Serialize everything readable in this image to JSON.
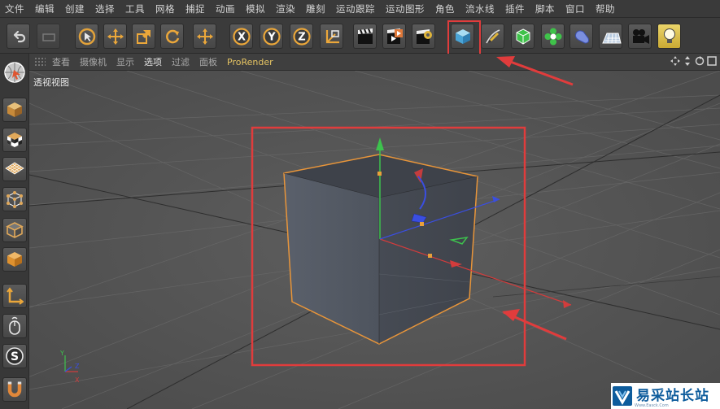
{
  "menubar": {
    "items": [
      "文件",
      "编辑",
      "创建",
      "选择",
      "工具",
      "网格",
      "捕捉",
      "动画",
      "模拟",
      "渲染",
      "雕刻",
      "运动跟踪",
      "运动图形",
      "角色",
      "流水线",
      "插件",
      "脚本",
      "窗口",
      "帮助"
    ]
  },
  "toolbar": {
    "buttons": [
      {
        "name": "undo",
        "icon": "undo-icon"
      },
      {
        "name": "redo",
        "icon": "redo-icon"
      },
      {
        "name": "live-select",
        "icon": "cursor-icon"
      },
      {
        "name": "move",
        "icon": "move-arrows-icon"
      },
      {
        "name": "scale",
        "icon": "scale-icon"
      },
      {
        "name": "rotate",
        "icon": "rotate-icon"
      },
      {
        "name": "recent-tool",
        "icon": "move-arrows-icon"
      },
      {
        "name": "x-axis",
        "label": "X"
      },
      {
        "name": "y-axis",
        "label": "Y"
      },
      {
        "name": "z-axis",
        "label": "Z"
      },
      {
        "name": "coordinate-system",
        "icon": "coordinate-icon"
      },
      {
        "name": "render-view",
        "icon": "clapboard-icon"
      },
      {
        "name": "render-picture-viewer",
        "icon": "clapboard-play-icon"
      },
      {
        "name": "render-settings",
        "icon": "clapboard-gear-icon"
      },
      {
        "name": "cube",
        "icon": "cube-icon"
      },
      {
        "name": "pen-spline",
        "icon": "pen-icon"
      },
      {
        "name": "subdivision",
        "icon": "subdivision-icon"
      },
      {
        "name": "cloner",
        "icon": "flower-icon"
      },
      {
        "name": "bend-deformer",
        "icon": "deformer-icon"
      },
      {
        "name": "floor",
        "icon": "floor-icon"
      },
      {
        "name": "camera",
        "icon": "camera-icon"
      },
      {
        "name": "light",
        "icon": "lightbulb-icon"
      }
    ]
  },
  "viewport": {
    "menu": [
      "查看",
      "摄像机",
      "显示",
      "选项",
      "过滤",
      "面板",
      "ProRender"
    ],
    "active_menu": "选项",
    "label": "透视视图"
  },
  "annotations": {
    "highlight_color": "#e03c3c"
  },
  "watermark": {
    "text": "易采站长站",
    "sub": "Www.Easck.Com"
  }
}
